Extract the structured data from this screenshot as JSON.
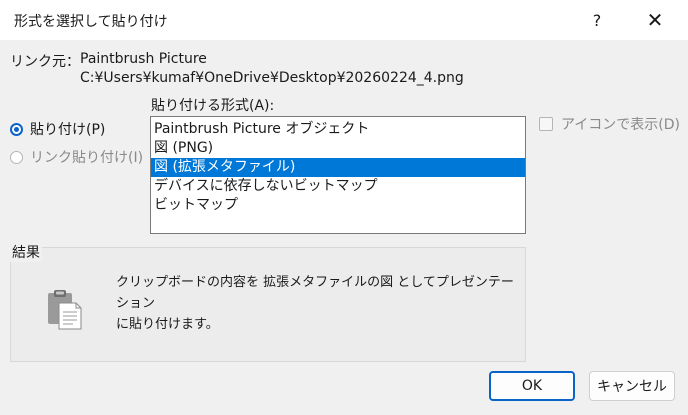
{
  "window": {
    "title": "形式を選択して貼り付け",
    "help_label": "?",
    "close_label": "✕"
  },
  "source": {
    "label": "リンク元：",
    "name": "Paintbrush Picture",
    "path": "C:¥Users¥kumaf¥OneDrive¥Desktop¥20260224_4.png"
  },
  "options": {
    "paste_label": "貼り付け(P)",
    "paste_link_label": "リンク貼り付け(I)",
    "paste_selected": true
  },
  "format_list": {
    "label": "貼り付ける形式(A):",
    "items": [
      "Paintbrush Picture オブジェクト",
      "図 (PNG)",
      "図 (拡張メタファイル)",
      "デバイスに依存しないビットマップ",
      "ビットマップ"
    ],
    "selected_index": 2
  },
  "display_as_icon": {
    "label": "アイコンで表示(D)",
    "checked": false
  },
  "result": {
    "title": "結果",
    "line1": "クリップボードの内容を 拡張メタファイルの図 としてプレゼンテーション",
    "line2": "に貼り付けます。",
    "icon": "clipboard-icon"
  },
  "buttons": {
    "ok": "OK",
    "cancel": "キャンセル"
  },
  "colors": {
    "accent": "#0078d7",
    "background": "#f0f0f0"
  }
}
